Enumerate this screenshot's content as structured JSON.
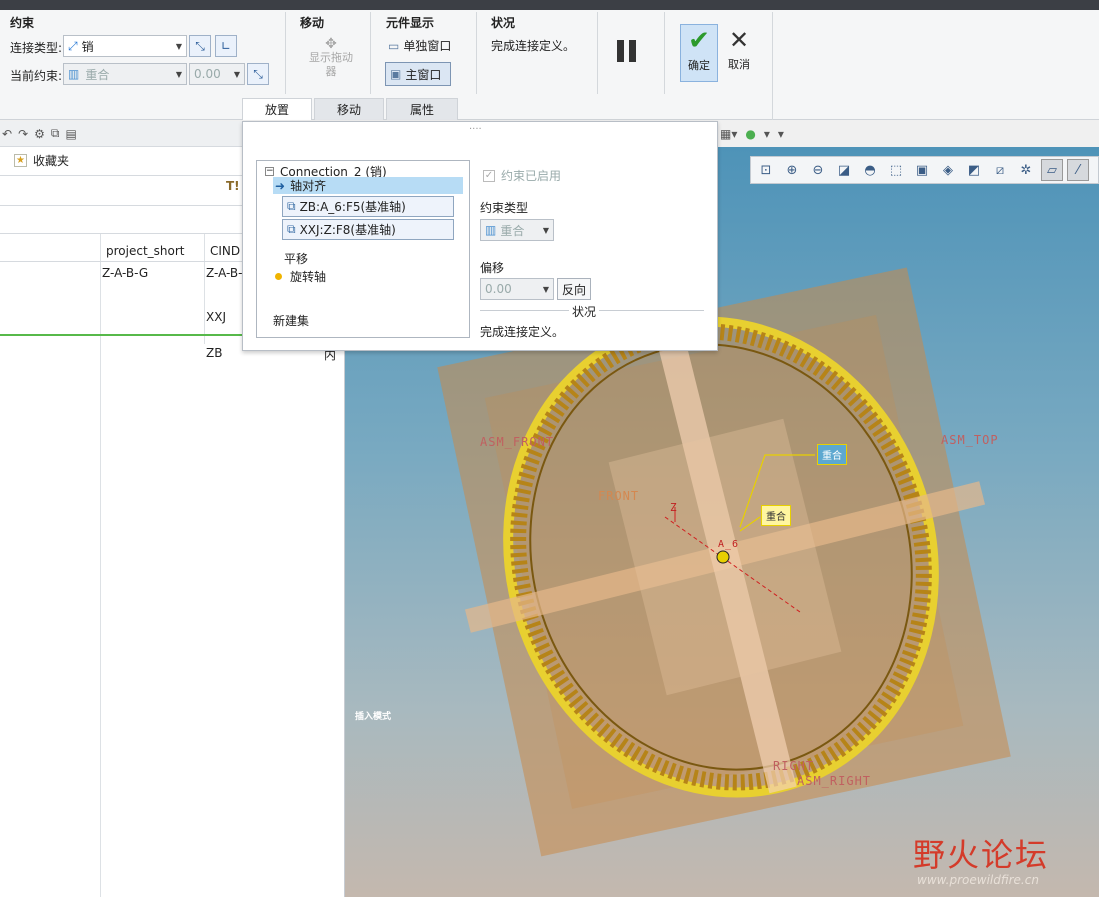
{
  "ribbon": {
    "constraint_group_title": "约束",
    "connection_type_label": "连接类型:",
    "connection_type_value": "销",
    "current_constraint_label": "当前约束:",
    "current_constraint_value": "重合",
    "current_offset_value": "0.00",
    "move_group_title": "移动",
    "show_drag_label": "显示拖动器",
    "component_display_title": "元件显示",
    "separate_window_label": "单独窗口",
    "main_window_label": "主窗口",
    "status_title": "状况",
    "status_text": "完成连接定义。",
    "ok_label": "确定",
    "cancel_label": "取消"
  },
  "tabs": [
    "放置",
    "移动",
    "属性"
  ],
  "popup": {
    "tree_root": "Connection_2 (销)",
    "selected_item": "轴对齐",
    "ref1": "ZB:A_6:F5(基准轴)",
    "ref2": "XXJ:Z:F8(基准轴)",
    "translation": "平移",
    "rotation_axis": "旋转轴",
    "new_set": "新建集",
    "constraint_enabled": "约束已启用",
    "constraint_type_label": "约束类型",
    "constraint_type_value": "重合",
    "offset_label": "偏移",
    "offset_value": "0.00",
    "flip_label": "反向",
    "status_label": "状况",
    "status_text": "完成连接定义。"
  },
  "left_panel": {
    "favorites": "收藏夹",
    "columns": [
      "project_short",
      "CIND"
    ],
    "rows": [
      {
        "project_short": "Z-A-B-G",
        "cind": "Z-A-B-"
      },
      {
        "project_short": "",
        "cind": "XXJ"
      },
      {
        "project_short": "",
        "cind": "ZB"
      }
    ],
    "row3_extra": "内"
  },
  "viewport": {
    "callout1": "重合",
    "callout2": "重合",
    "datum_labels": [
      "ASM_FRONT",
      "ASM_TOP",
      "FRONT",
      "RIGHT",
      "ASM_RIGHT",
      "A_6",
      "Z"
    ],
    "mode_text": "插入模式",
    "watermark_title": "野火论坛",
    "watermark_url": "www.proewildfire.cn"
  },
  "colors": {
    "accent": "#2b7bd6",
    "gear": "#c8961e",
    "plane": "#c98a4a"
  }
}
